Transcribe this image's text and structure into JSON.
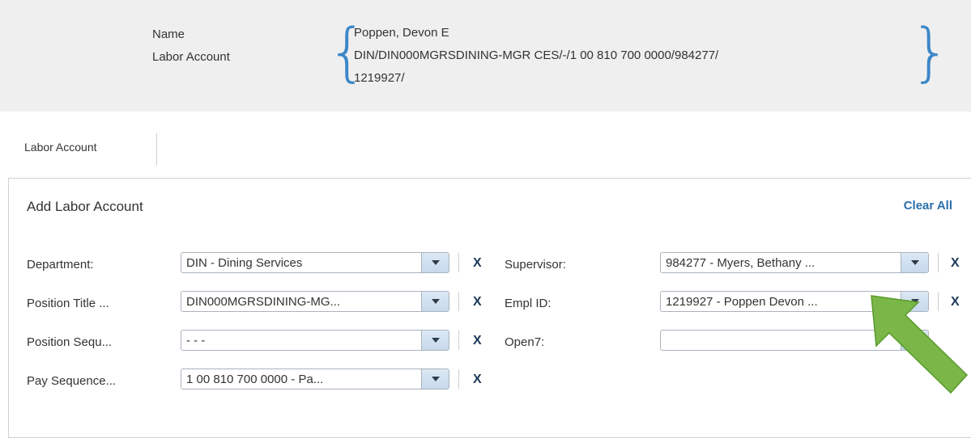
{
  "summary": {
    "name_label": "Name",
    "labor_account_label": "Labor Account",
    "name_value": "Poppen, Devon E",
    "labor_account_line1": "DIN/DIN000MGRSDINING-MGR CES/-/1 00 810 700 0000/984277/",
    "labor_account_line2": "1219927/"
  },
  "tabs": {
    "labor_account": "Labor Account"
  },
  "panel": {
    "title": "Add Labor Account",
    "clear_all": "Clear All",
    "clear_icon_glyph": "X",
    "left_fields": [
      {
        "label": "Department:",
        "value": "DIN - Dining Services"
      },
      {
        "label": "Position Title ...",
        "value": "DIN000MGRSDINING-MG..."
      },
      {
        "label": "Position Sequ...",
        "value": "- - -"
      },
      {
        "label": "Pay Sequence...",
        "value": "1 00  810  700  0000 - Pa..."
      }
    ],
    "right_fields": [
      {
        "label": "Supervisor:",
        "value": "984277 - Myers, Bethany ..."
      },
      {
        "label": "Empl ID:",
        "value": "1219927 - Poppen Devon ..."
      },
      {
        "label": "Open7:",
        "value": ""
      }
    ]
  },
  "colors": {
    "accent": "#3b87c8",
    "link": "#2a6fac",
    "arrow": "#7ab648"
  },
  "icons": {
    "dropdown": "chevron-down-icon",
    "clear": "close-icon",
    "annotation": "arrow-annotation-icon"
  }
}
